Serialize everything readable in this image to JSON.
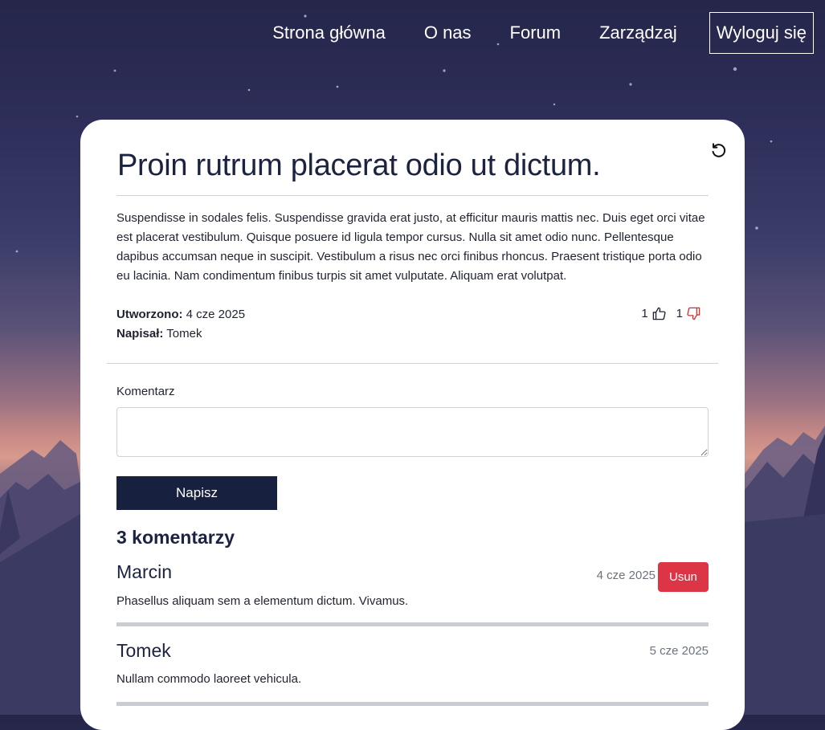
{
  "nav": {
    "items": [
      {
        "label": "Strona główna"
      },
      {
        "label": "O nas"
      },
      {
        "label": "Forum"
      },
      {
        "label": "Zarządzaj"
      }
    ],
    "logout_label": "Wyloguj się"
  },
  "post": {
    "title": "Proin rutrum placerat odio ut dictum.",
    "body": "Suspendisse in sodales felis. Suspendisse gravida erat justo, at efficitur mauris mattis nec. Duis eget orci vitae est placerat vestibulum. Quisque posuere id ligula tempor cursus. Nulla sit amet odio nunc. Pellentesque dapibus accumsan neque in suscipit. Vestibulum a risus nec orci finibus rhoncus. Praesent tristique porta odio eu lacinia. Nam condimentum finibus turpis sit amet vulputate. Aliquam erat volutpat.",
    "created_label": "Utworzono:",
    "created_value": "4 cze 2025",
    "author_label": "Napisał:",
    "author_value": "Tomek",
    "likes": "1",
    "dislikes": "1",
    "like_color": "#1f2330",
    "dislike_color": "#d32f2f"
  },
  "comment_form": {
    "label": "Komentarz",
    "value": "",
    "placeholder": "",
    "submit_label": "Napisz"
  },
  "comments": {
    "heading": "3 komentarzy",
    "items": [
      {
        "author": "Marcin",
        "date": "4 cze 2025",
        "text": "Phasellus aliquam sem a elementum dictum. Vivamus.",
        "delete_label": "Usun"
      },
      {
        "author": "Tomek",
        "date": "5 cze 2025",
        "text": "Nullam commodo laoreet vehicula."
      }
    ]
  },
  "colors": {
    "primary": "#17203f",
    "danger": "#dc3545"
  }
}
